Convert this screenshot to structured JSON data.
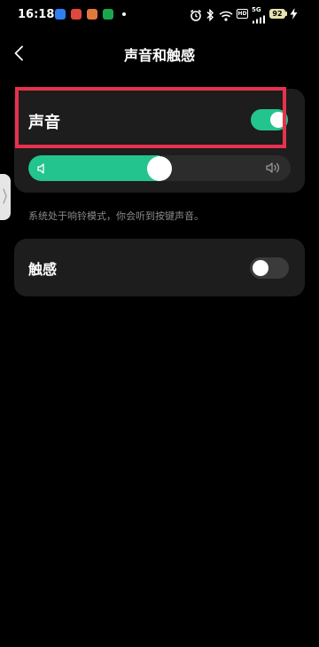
{
  "status_bar": {
    "time": "16:18",
    "notification_icons": [
      {
        "name": "app-notification-blue-icon",
        "color": "#2f7ff0"
      },
      {
        "name": "app-notification-red-icon",
        "color": "#e0483b"
      },
      {
        "name": "app-notification-orange-icon",
        "color": "#e0783b"
      },
      {
        "name": "app-notification-green-icon",
        "color": "#17a84e"
      }
    ],
    "system_icons": [
      "alarm-icon",
      "bluetooth-icon",
      "wifi-icon",
      "hd-icon",
      "signal-icon"
    ],
    "network_type": "5G",
    "hd_label": "HD",
    "battery_percent": "92",
    "charging": true
  },
  "header": {
    "title": "声音和触感",
    "back_icon": "chevron-left-icon"
  },
  "sound": {
    "label": "声音",
    "enabled": true,
    "volume_level": 0.5,
    "min_icon": "volume-low-icon",
    "max_icon": "volume-high-icon",
    "description": "系统处于响铃模式，你会听到按键声音。"
  },
  "haptics": {
    "label": "触感",
    "enabled": false
  },
  "colors": {
    "accent": "#24c48e",
    "highlight": "#e8314e",
    "card": "#1d1d1d",
    "background": "#000000"
  }
}
